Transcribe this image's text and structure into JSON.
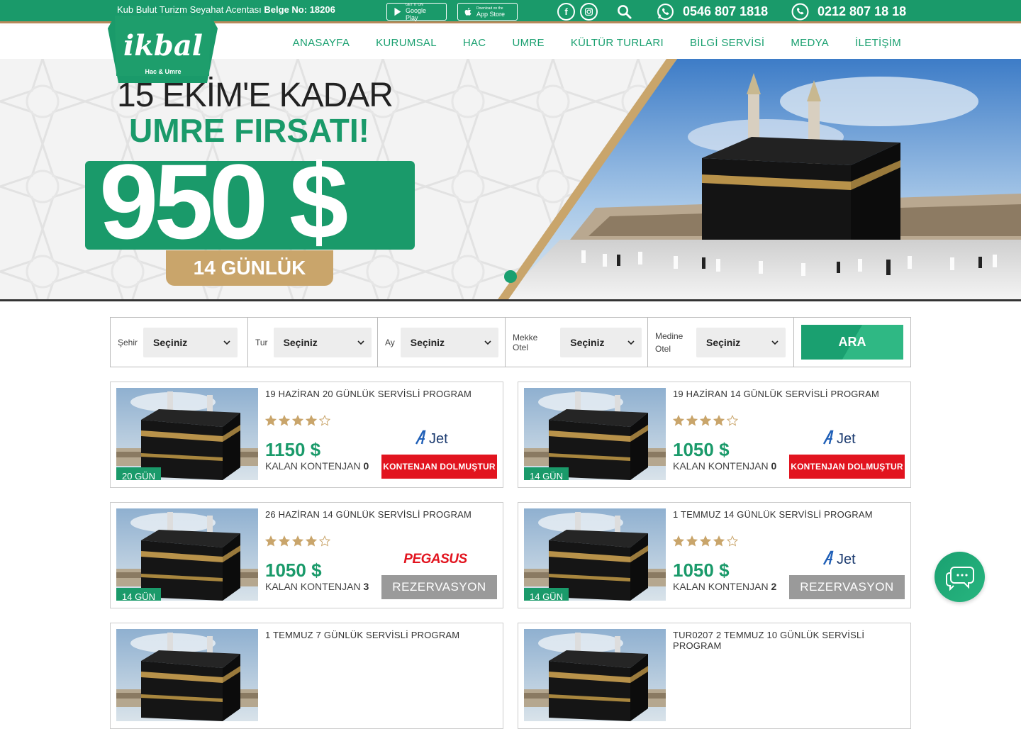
{
  "topbar": {
    "agency": "Kub Bulut Turizm Seyahat Acentası",
    "license": "Belge No: 18206",
    "google_play_small": "GET IT ON",
    "google_play": "Google Play",
    "app_store_small": "Download on the",
    "app_store": "App Store",
    "phone_whatsapp": "0546 807 1818",
    "phone_main": "0212 807 18 18"
  },
  "logo": {
    "name": "ikbal",
    "sub": "Hac & Umre"
  },
  "nav": [
    "ANASAYFA",
    "KURUMSAL",
    "HAC",
    "UMRE",
    "KÜLTÜR TURLARI",
    "BİLGİ SERVİSİ",
    "MEDYA",
    "İLETİŞİM"
  ],
  "hero": {
    "line1": "15 EKİM'E KADAR",
    "line2": "UMRE FIRSATI!",
    "price": "950 $",
    "duration": "14 GÜNLÜK"
  },
  "search": {
    "fields": [
      {
        "label": "Şehir",
        "value": "Seçiniz"
      },
      {
        "label": "Tur",
        "value": "Seçiniz"
      },
      {
        "label": "Ay",
        "value": "Seçiniz"
      },
      {
        "label": "Mekke Otel",
        "value": "Seçiniz"
      },
      {
        "label": "Medine Otel",
        "value": "Seçiniz"
      }
    ],
    "button": "ARA"
  },
  "programs": [
    {
      "title": "19 HAZİRAN 20 GÜNLÜK SERVİSLİ PROGRAM",
      "days": "20 GÜN",
      "stars": 4,
      "price": "1150 $",
      "quota_label": "KALAN KONTENJAN",
      "quota": "0",
      "airline": "AJet",
      "status": "full",
      "button": "KONTENJAN DOLMUŞTUR"
    },
    {
      "title": "19 HAZİRAN 14 GÜNLÜK SERVİSLİ PROGRAM",
      "days": "14 GÜN",
      "stars": 4,
      "price": "1050 $",
      "quota_label": "KALAN KONTENJAN",
      "quota": "0",
      "airline": "AJet",
      "status": "full",
      "button": "KONTENJAN DOLMUŞTUR"
    },
    {
      "title": "26 HAZİRAN 14 GÜNLÜK SERVİSLİ PROGRAM",
      "days": "14 GÜN",
      "stars": 4,
      "price": "1050 $",
      "quota_label": "KALAN KONTENJAN",
      "quota": "3",
      "airline": "PEGASUS",
      "status": "open",
      "button": "REZERVASYON"
    },
    {
      "title": "1 TEMMUZ 14 GÜNLÜK SERVİSLİ PROGRAM",
      "days": "14 GÜN",
      "stars": 4,
      "price": "1050 $",
      "quota_label": "KALAN KONTENJAN",
      "quota": "2",
      "airline": "AJet",
      "status": "open",
      "button": "REZERVASYON"
    },
    {
      "title": "1 TEMMUZ 7 GÜNLÜK SERVİSLİ PROGRAM"
    },
    {
      "title": "TUR0207 2 TEMMUZ 10 GÜNLÜK SERVİSLİ PROGRAM"
    }
  ],
  "colors": {
    "brand_green": "#1a9a6a",
    "gold": "#c9a56b",
    "full_red": "#e2141f",
    "reserve_gray": "#9a9a9a"
  }
}
